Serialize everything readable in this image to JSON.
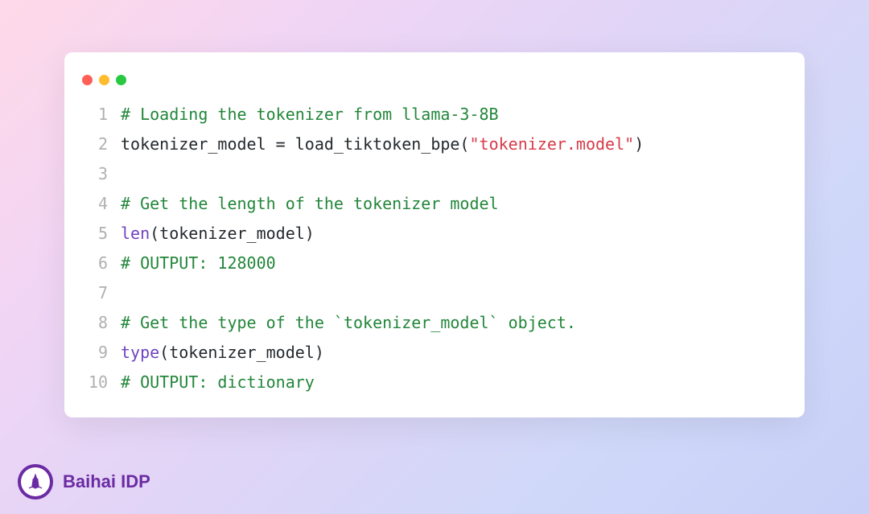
{
  "brand": {
    "name": "Baihai IDP"
  },
  "code": {
    "lines": [
      {
        "num": "1",
        "tokens": [
          {
            "cls": "comment",
            "text": "# Loading the tokenizer from llama-3-8B"
          }
        ]
      },
      {
        "num": "2",
        "tokens": [
          {
            "cls": "identifier",
            "text": "tokenizer_model = load_tiktoken_bpe("
          },
          {
            "cls": "string",
            "text": "\"tokenizer.model\""
          },
          {
            "cls": "identifier",
            "text": ")"
          }
        ]
      },
      {
        "num": "3",
        "tokens": []
      },
      {
        "num": "4",
        "tokens": [
          {
            "cls": "comment",
            "text": "# Get the length of the tokenizer model"
          }
        ]
      },
      {
        "num": "5",
        "tokens": [
          {
            "cls": "builtin",
            "text": "len"
          },
          {
            "cls": "identifier",
            "text": "(tokenizer_model)"
          }
        ]
      },
      {
        "num": "6",
        "tokens": [
          {
            "cls": "comment",
            "text": "# OUTPUT: 128000"
          }
        ]
      },
      {
        "num": "7",
        "tokens": []
      },
      {
        "num": "8",
        "tokens": [
          {
            "cls": "comment",
            "text": "# Get the type of the `tokenizer_model` object."
          }
        ]
      },
      {
        "num": "9",
        "tokens": [
          {
            "cls": "builtin",
            "text": "type"
          },
          {
            "cls": "identifier",
            "text": "(tokenizer_model)"
          }
        ]
      },
      {
        "num": "10",
        "tokens": [
          {
            "cls": "comment",
            "text": "# OUTPUT: dictionary"
          }
        ]
      }
    ]
  }
}
